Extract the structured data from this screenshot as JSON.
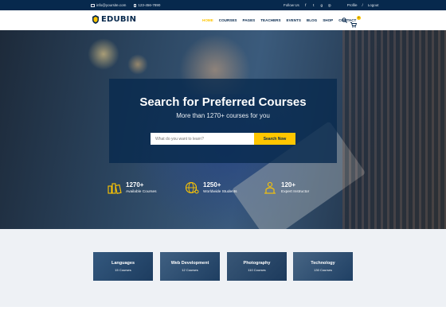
{
  "topbar": {
    "email": "info@yoursite.com",
    "phone": "123-456-7890",
    "follow_label": "Follow Us",
    "social_icons": [
      "facebook-icon",
      "twitter-icon",
      "google-plus-icon",
      "instagram-icon"
    ],
    "profile_label": "Profile",
    "separator": "/",
    "logout_label": "Logout"
  },
  "nav": {
    "logo_text": "EDUBIN",
    "items": [
      {
        "label": "HOME",
        "active": true
      },
      {
        "label": "COURSES"
      },
      {
        "label": "PAGES"
      },
      {
        "label": "TEACHERS"
      },
      {
        "label": "EVENTS"
      },
      {
        "label": "BLOG"
      },
      {
        "label": "SHOP"
      },
      {
        "label": "CONTACT"
      }
    ],
    "cart_count": "0"
  },
  "hero": {
    "title": "Search for Preferred Courses",
    "subtitle": "More than 1270+ courses for you",
    "search_placeholder": "What do you want to learn?",
    "search_button": "Search Now",
    "stats": [
      {
        "number": "1270+",
        "label": "Available Courses",
        "icon": "books-icon"
      },
      {
        "number": "1250+",
        "label": "Worldwide Students",
        "icon": "globe-students-icon"
      },
      {
        "number": "120+",
        "label": "Expert Instructor",
        "icon": "instructor-icon"
      }
    ]
  },
  "categories": [
    {
      "title": "Languages",
      "count": "15 Courses"
    },
    {
      "title": "Web Development",
      "count": "12 Courses"
    },
    {
      "title": "Photography",
      "count": "110 Courses"
    },
    {
      "title": "Technology",
      "count": "130 Courses"
    }
  ],
  "colors": {
    "navy": "#07294d",
    "accent": "#ffc600",
    "light_bg": "#eef1f5"
  }
}
